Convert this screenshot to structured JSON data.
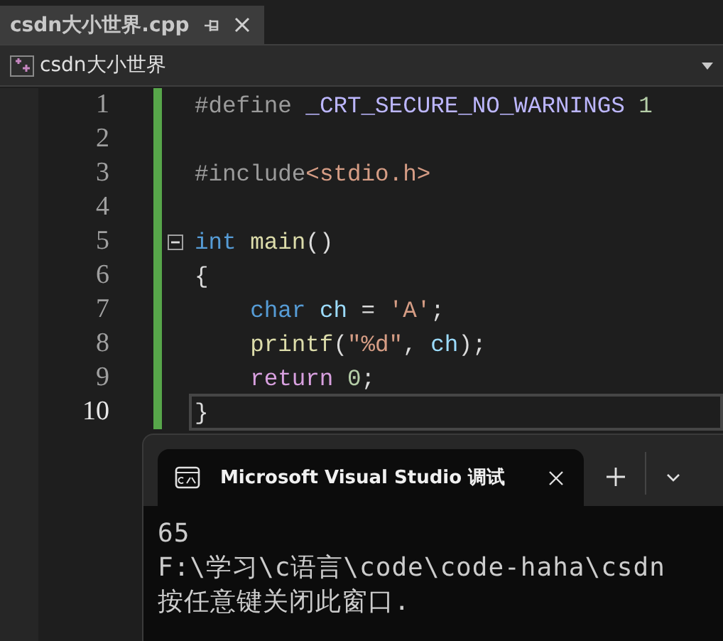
{
  "document_tab": {
    "title": "csdn大小世界.cpp",
    "selected": true
  },
  "navigation_bar": {
    "scope": "csdn大小世界"
  },
  "editor": {
    "lines": [
      {
        "number": "1",
        "current": false,
        "fold_start": false,
        "tokens": [
          {
            "text": "#define ",
            "kind": "preprocessor"
          },
          {
            "text": "_CRT_SECURE_NO_WARNINGS",
            "kind": "macro"
          },
          {
            "text": " 1",
            "kind": "number"
          }
        ]
      },
      {
        "number": "2",
        "current": false,
        "fold_start": false
      },
      {
        "number": "3",
        "current": false,
        "fold_start": false,
        "tokens": [
          {
            "text": "#include",
            "kind": "preprocessor"
          },
          {
            "text": "<stdio.h>",
            "kind": "string"
          }
        ]
      },
      {
        "number": "4",
        "current": false,
        "fold_start": false
      },
      {
        "number": "5",
        "current": false,
        "fold_start": true,
        "tokens": [
          {
            "text": "int",
            "kind": "keyword"
          },
          {
            "text": " main",
            "kind": "function"
          },
          {
            "text": "()",
            "kind": "plain"
          }
        ]
      },
      {
        "number": "6",
        "current": false,
        "fold_start": false,
        "tokens": [
          {
            "text": "{",
            "kind": "plain"
          }
        ]
      },
      {
        "number": "7",
        "current": false,
        "fold_start": false,
        "tokens": [
          {
            "text": "    char",
            "kind": "keyword"
          },
          {
            "text": " ch",
            "kind": "variable"
          },
          {
            "text": " = ",
            "kind": "plain"
          },
          {
            "text": "'A'",
            "kind": "string"
          },
          {
            "text": ";",
            "kind": "plain"
          }
        ]
      },
      {
        "number": "8",
        "current": false,
        "fold_start": false,
        "tokens": [
          {
            "text": "    printf",
            "kind": "function"
          },
          {
            "text": "(",
            "kind": "plain"
          },
          {
            "text": "\"%d\"",
            "kind": "string"
          },
          {
            "text": ", ",
            "kind": "plain"
          },
          {
            "text": "ch",
            "kind": "variable"
          },
          {
            "text": ");",
            "kind": "plain"
          }
        ]
      },
      {
        "number": "9",
        "current": false,
        "fold_start": false,
        "tokens": [
          {
            "text": "    return",
            "kind": "control"
          },
          {
            "text": " 0",
            "kind": "number"
          },
          {
            "text": ";",
            "kind": "plain"
          }
        ]
      },
      {
        "number": "10",
        "current": true,
        "fold_start": false,
        "tokens": [
          {
            "text": "}",
            "kind": "plain"
          }
        ]
      }
    ]
  },
  "terminal": {
    "tab_title": "Microsoft Visual Studio 调试",
    "output": [
      "65",
      "F:\\学习\\c语言\\code\\code-haha\\csdn",
      "按任意键关闭此窗口."
    ]
  }
}
